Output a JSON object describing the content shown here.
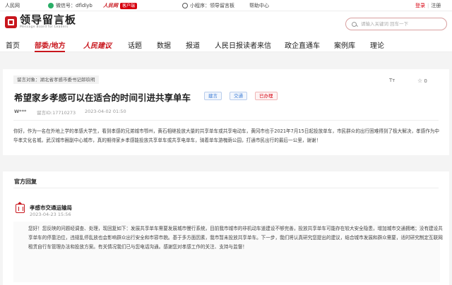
{
  "topbar": {
    "site_label": "人民网",
    "wechat_label": "微信号：dfldlyb",
    "people_logo": "人民网",
    "client_label": "客户端",
    "miniprogram_label": "小程序：领导留言板",
    "help_label": "帮助中心",
    "login_label": "登录",
    "register_label": "注册"
  },
  "header": {
    "brand_title": "领导留言板",
    "brand_sub": "Message Board for Leaders",
    "search_placeholder": "请输入关键词 回车一下"
  },
  "nav": {
    "items": [
      "首页",
      "部委/地方",
      "人民建议",
      "话题",
      "数据",
      "报道",
      "人民日报读者来信",
      "政企直通车",
      "案例库",
      "理论"
    ],
    "active": "部委/地方"
  },
  "post": {
    "target": "留言对象：湖北省孝感市委书记郎玖明",
    "font_tool": "Tт",
    "star_count": "0",
    "title": "希望家乡孝感可以在适合的时间引进共享单车",
    "tags": [
      "建言",
      "交通"
    ],
    "status": "已办理",
    "author": "W***",
    "id": "留言ID:17710273",
    "datetime": "2023-04-02 01:50",
    "content": "你好，作为一名在外地上学的孝感大学生，看到孝感的兄弟城市鄂州，黄石相继投放大量的共享单车或共享电动车，黄冈市也于2021年7月15日起投放单车，市民群众的出行困难得到了极大解决，孝感作为中华孝文化名城，武汉城市圈副中心城市，真的期待家乡孝感能投放共享单车或共享电单车，骑着单车游槐荫公园，打通市民出行的最后一公里，谢谢！"
  },
  "reply": {
    "section_title": "官方回复",
    "org": "孝感市交通运输局",
    "datetime": "2023-04-23 15:56",
    "content": "您好！您反映的问题经调查、处理，现回复如下：发展共享单车需要发展城市慢行系统，目前我市城市的非机动车道建设不够完善，投放共享单车可能存在较大安全隐患，增加城市交通拥堵；没有建设共享单车的停靠泊位，违规乱停乱放也会影响群众出行安全和市容市貌。基于多方面因素，我市暂未投放共享单车。下一步，我们将认真研究您提出的建议，结合城市发展和群众需要，适时研究制定互联网租赁自行车管理办法和投放方案。有关情况我们已与您电话沟通。感谢您对孝感工作的关注、支持与监督！"
  },
  "colors": {
    "brand_red": "#c8161d",
    "tag_blue": "#3a7bd5",
    "status_red": "#d7000f"
  }
}
